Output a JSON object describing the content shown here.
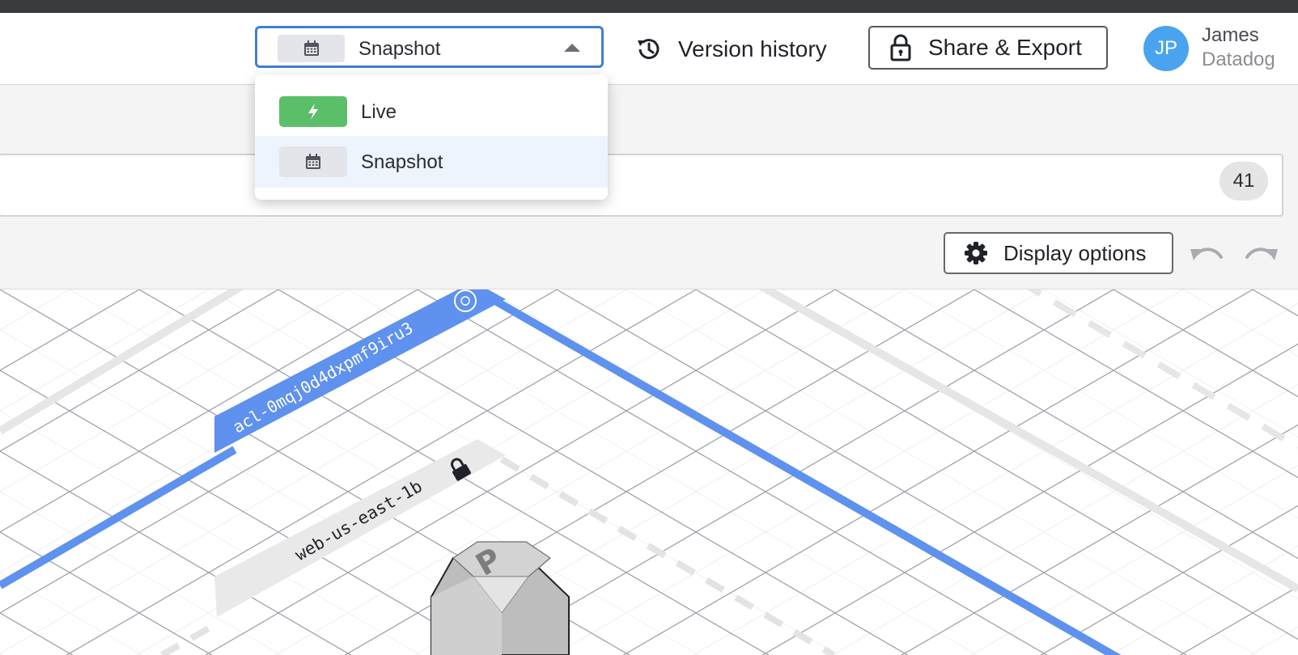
{
  "header": {
    "mode_select": {
      "selected_label": "Snapshot",
      "icon": "calendar-icon"
    },
    "version_history": {
      "label": "Version history",
      "icon": "history-icon"
    },
    "share_export": {
      "label": "Share & Export",
      "icon": "lock-icon"
    },
    "user": {
      "initials": "JP",
      "name": "James",
      "org": "Datadog",
      "avatar_color": "#4aa3ef"
    }
  },
  "dropdown": {
    "options": [
      {
        "label": "Live",
        "icon": "bolt-icon",
        "color": "#5bbf6a"
      },
      {
        "label": "Snapshot",
        "icon": "calendar-icon",
        "selected": true
      }
    ]
  },
  "toolbar": {
    "result_count": "41",
    "display_options_label": "Display options",
    "display_options_icon": "gear-icon",
    "undo_icon": "undo-icon",
    "redo_icon": "redo-icon"
  },
  "canvas": {
    "acl_label": "acl-0mqj0d4dxpmf9iru3",
    "subnet_label": "web-us-east-1b",
    "node_letter": "P",
    "accent_color": "#5f91ee"
  }
}
